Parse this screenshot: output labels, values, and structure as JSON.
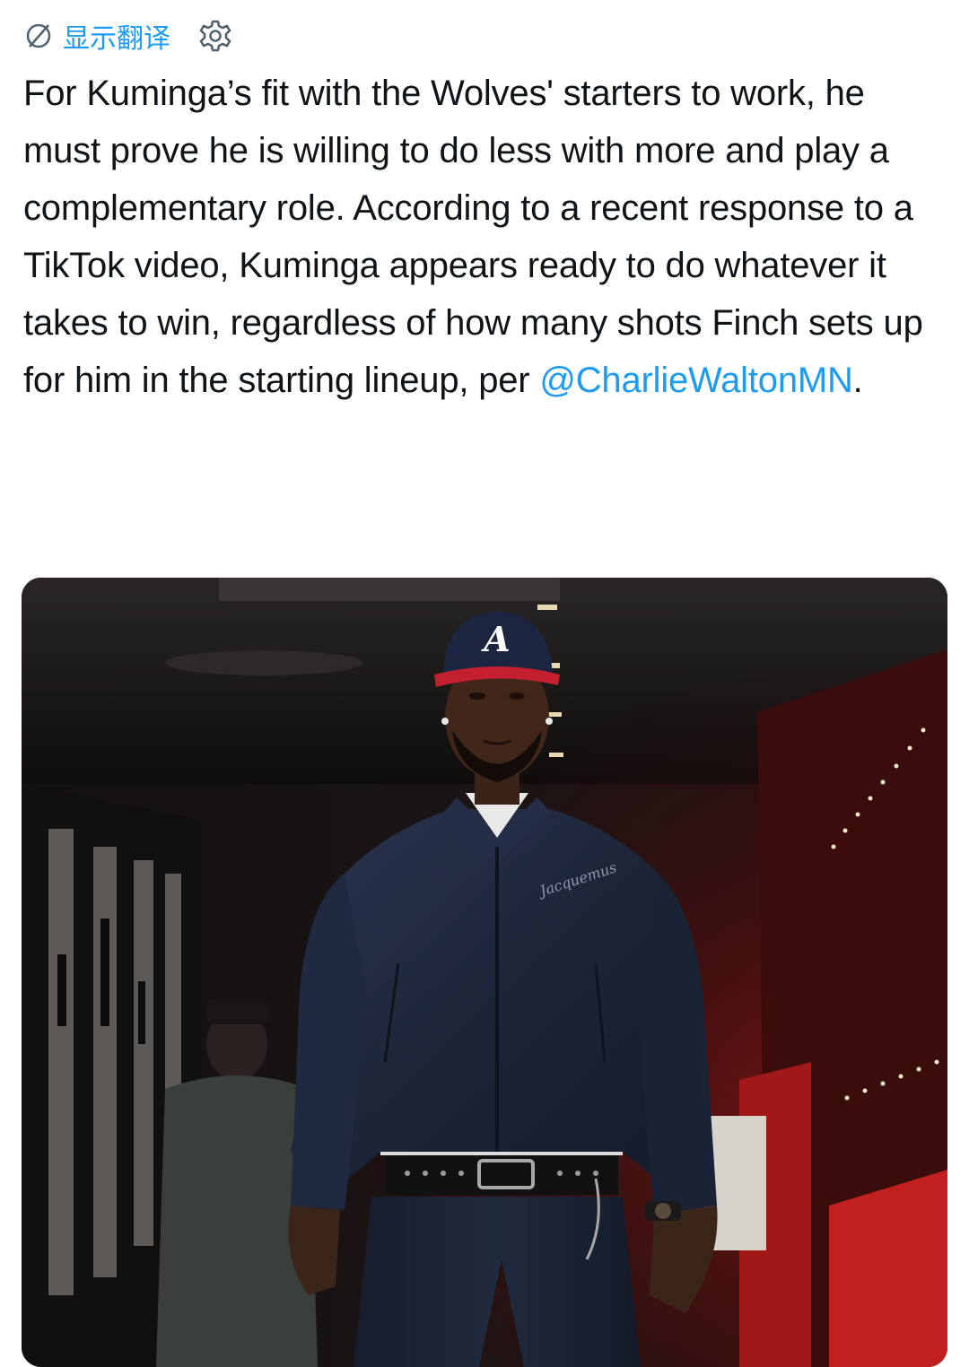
{
  "translate": {
    "label": "显示翻译",
    "icon": "translate-icon",
    "settings_icon": "gear-icon"
  },
  "tweet": {
    "text": "For Kuminga’s fit with the Wolves' starters to work, he must prove he is willing to do less with more and play a complementary role. According to a recent response to a TikTok video, Kuminga appears ready to do whatever it takes to win, regardless of how many shots Finch sets up for him in the starting lineup, per ",
    "mention": "@CharlieWaltonMN",
    "trailing": "."
  },
  "media": {
    "jacket_brand": "Jacquemus"
  },
  "colors": {
    "link": "#1d9bf0",
    "text": "#0f1419"
  }
}
